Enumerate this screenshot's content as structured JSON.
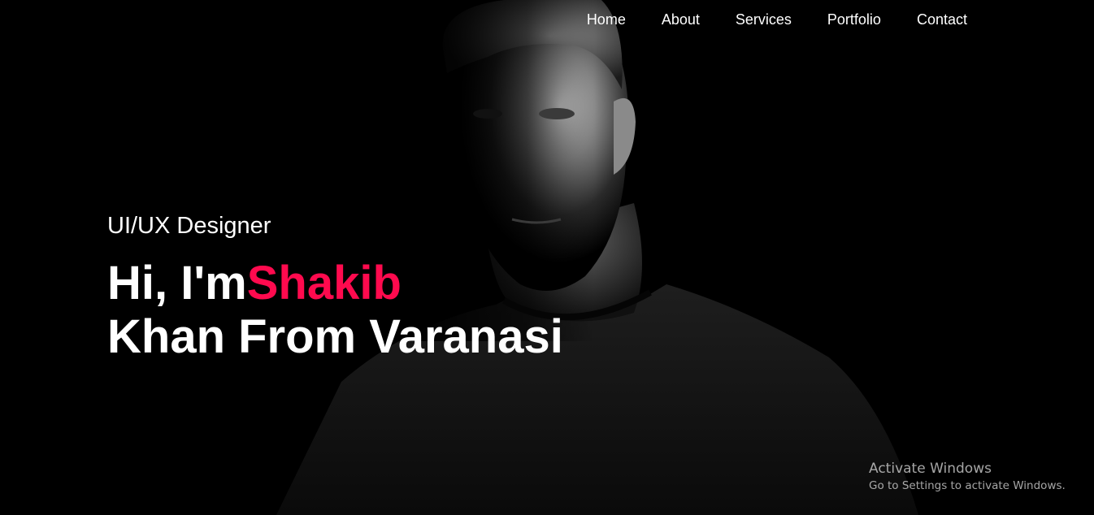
{
  "nav": {
    "items": [
      {
        "label": "Home"
      },
      {
        "label": "About"
      },
      {
        "label": "Services"
      },
      {
        "label": "Portfolio"
      },
      {
        "label": "Contact"
      }
    ]
  },
  "hero": {
    "role": "UI/UX Designer",
    "greeting": "Hi, I'm",
    "first_name": "Shakib",
    "line2": "Khan From Varanasi",
    "accent_color": "#ff0a4e",
    "background_color": "#000000"
  },
  "watermark": {
    "title": "Activate Windows",
    "subtitle": "Go to Settings to activate Windows."
  }
}
